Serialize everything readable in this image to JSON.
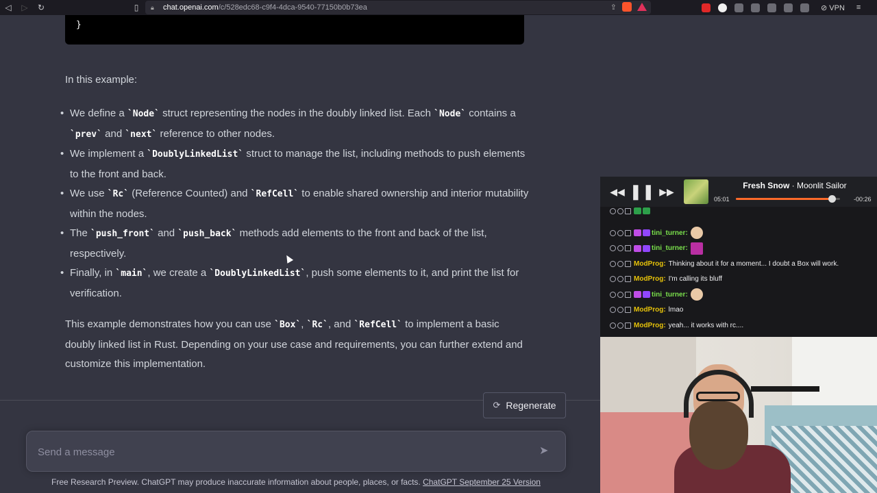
{
  "browser": {
    "url_host": "chat.openai.com",
    "url_path": "/c/528edc68-c9f4-4dca-9540-77150b0b73ea",
    "vpn_label": "VPN"
  },
  "code": {
    "closing_brace": "}"
  },
  "response": {
    "intro": "In this example:",
    "bullets": [
      [
        {
          "t": "We define a "
        },
        {
          "c": "`Node`"
        },
        {
          "t": " struct representing the nodes in the doubly linked list. Each "
        },
        {
          "c": "`Node`"
        },
        {
          "t": " contains a "
        },
        {
          "c": "`prev`"
        },
        {
          "t": " and "
        },
        {
          "c": "`next`"
        },
        {
          "t": " reference to other nodes."
        }
      ],
      [
        {
          "t": "We implement a "
        },
        {
          "c": "`DoublyLinkedList`"
        },
        {
          "t": " struct to manage the list, including methods to push elements to the front and back."
        }
      ],
      [
        {
          "t": "We use "
        },
        {
          "c": "`Rc`"
        },
        {
          "t": " (Reference Counted) and "
        },
        {
          "c": "`RefCell`"
        },
        {
          "t": " to enable shared ownership and interior mutability within the nodes."
        }
      ],
      [
        {
          "t": "The "
        },
        {
          "c": "`push_front`"
        },
        {
          "t": " and "
        },
        {
          "c": "`push_back`"
        },
        {
          "t": " methods add elements to the front and back of the list, respectively."
        }
      ],
      [
        {
          "t": "Finally, in "
        },
        {
          "c": "`main`"
        },
        {
          "t": ", we create a "
        },
        {
          "c": "`DoublyLinkedList`"
        },
        {
          "t": ", push some elements to it, and print the list for verification."
        }
      ]
    ],
    "outro": [
      {
        "t": "This example demonstrates how you can use "
      },
      {
        "c": "`Box`"
      },
      {
        "t": ", "
      },
      {
        "c": "`Rc`"
      },
      {
        "t": ", and "
      },
      {
        "c": "`RefCell`"
      },
      {
        "t": " to implement a basic doubly linked list in Rust. Depending on your use case and requirements, you can further extend and customize this implementation."
      }
    ]
  },
  "composer": {
    "regenerate_label": "Regenerate",
    "placeholder": "Send a message",
    "footer_text": "Free Research Preview. ChatGPT may produce inaccurate information about people, places, or facts. ",
    "footer_link": "ChatGPT September 25 Version"
  },
  "player": {
    "artist": "Fresh Snow",
    "separator": " · ",
    "title": "Moonlit Sailor",
    "elapsed": "05:01",
    "remaining": "-00:26",
    "progress_fraction": 0.92
  },
  "twitch_chat": {
    "messages": [
      {
        "user": "tini_turner",
        "text": "",
        "color": "green",
        "emote": "face",
        "badges": true
      },
      {
        "user": "tini_turner",
        "text": "",
        "color": "green",
        "emote": "text",
        "badges": true
      },
      {
        "user": "ModProg",
        "text": "Thinking about it for a moment... I doubt a Box will work.",
        "color": "yellow",
        "emote": "",
        "badges": false
      },
      {
        "user": "ModProg",
        "text": "I'm calling its bluff",
        "color": "yellow",
        "emote": "",
        "badges": false
      },
      {
        "user": "tini_turner",
        "text": "",
        "color": "green",
        "emote": "face",
        "badges": true
      },
      {
        "user": "ModProg",
        "text": "lmao",
        "color": "yellow",
        "emote": "",
        "badges": false
      },
      {
        "user": "ModProg",
        "text": "yeah... it works with rc....",
        "color": "yellow",
        "emote": "",
        "badges": false
      }
    ]
  },
  "colors": {
    "chat_bg": "#343541",
    "accent_orange": "#ff6a2a",
    "mod_yellow": "#e6c20a",
    "user_green": "#7ae04c"
  }
}
